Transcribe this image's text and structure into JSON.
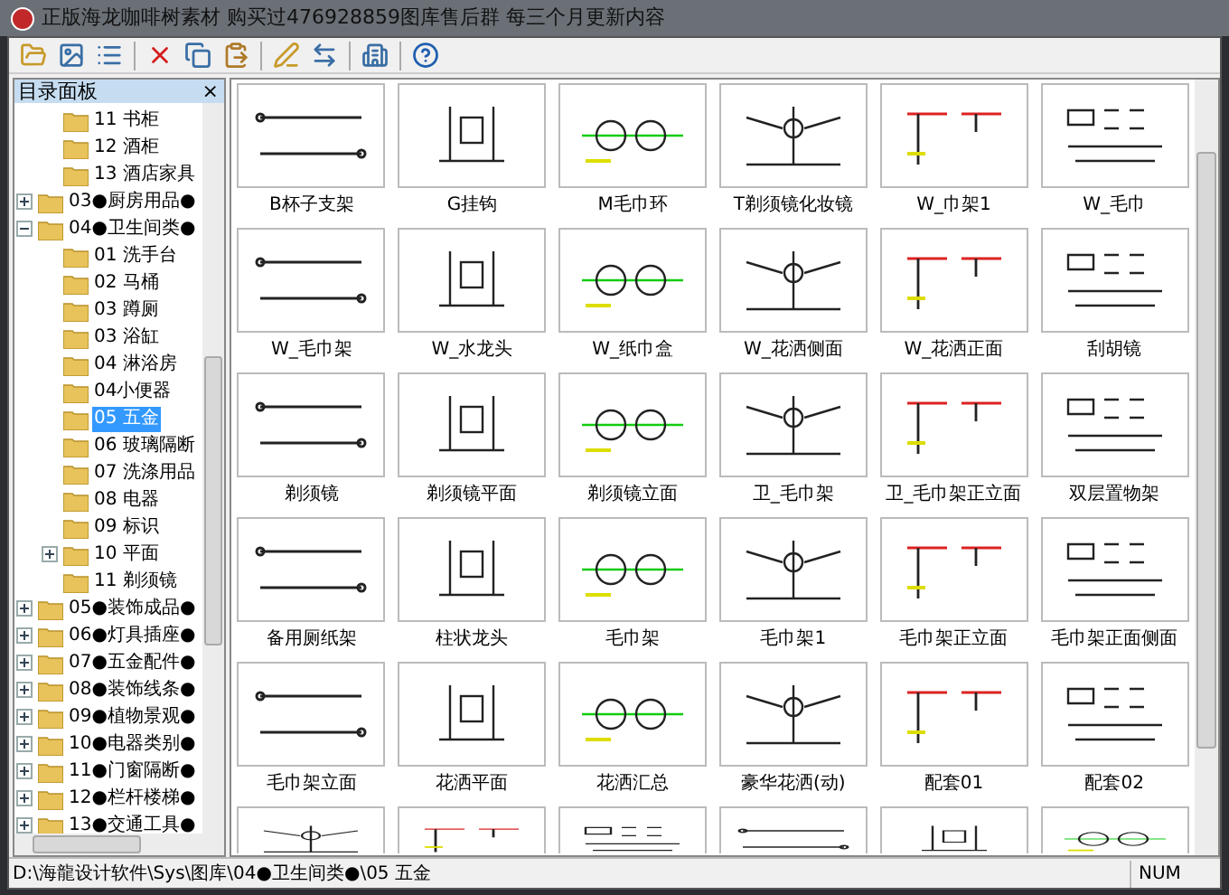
{
  "window": {
    "title": "正版海龙咖啡树素材 购买过476928859图库售后群 每三个月更新内容"
  },
  "catalog_panel": {
    "title": "目录面板",
    "close": "×",
    "continued_children": [
      {
        "label": "11 书柜",
        "selected": false
      },
      {
        "label": "12 酒柜",
        "selected": false
      },
      {
        "label": "13 酒店家具",
        "selected": false
      }
    ],
    "items": [
      {
        "label": "03●厨房用品●",
        "expanded": false,
        "selected": false
      },
      {
        "label": "04●卫生间类●",
        "expanded": true,
        "selected": false,
        "children": [
          {
            "label": "01 洗手台",
            "selected": false
          },
          {
            "label": "02 马桶",
            "selected": false
          },
          {
            "label": "03 蹲厕",
            "selected": false
          },
          {
            "label": "03 浴缸",
            "selected": false
          },
          {
            "label": "04 淋浴房",
            "selected": false
          },
          {
            "label": "04小便器",
            "selected": false
          },
          {
            "label": "05 五金",
            "selected": true
          },
          {
            "label": "06 玻璃隔断",
            "selected": false
          },
          {
            "label": "07 洗涤用品",
            "selected": false
          },
          {
            "label": "08 电器",
            "selected": false
          },
          {
            "label": "09 标识",
            "selected": false
          },
          {
            "label": "10 平面",
            "expanded": false,
            "selected": false
          },
          {
            "label": "11 剃须镜",
            "selected": false
          }
        ]
      },
      {
        "label": "05●装饰成品●",
        "expanded": false,
        "selected": false
      },
      {
        "label": "06●灯具插座●",
        "expanded": false,
        "selected": false
      },
      {
        "label": "07●五金配件●",
        "expanded": false,
        "selected": false
      },
      {
        "label": "08●装饰线条●",
        "expanded": false,
        "selected": false
      },
      {
        "label": "09●植物景观●",
        "expanded": false,
        "selected": false
      },
      {
        "label": "10●电器类别●",
        "expanded": false,
        "selected": false
      },
      {
        "label": "11●门窗隔断●",
        "expanded": false,
        "selected": false
      },
      {
        "label": "12●栏杆楼梯●",
        "expanded": false,
        "selected": false
      },
      {
        "label": "13●交通工具●",
        "expanded": false,
        "selected": false
      }
    ]
  },
  "gallery": {
    "items": [
      {
        "label": "B杯子支架"
      },
      {
        "label": "G挂钩"
      },
      {
        "label": "M毛巾环"
      },
      {
        "label": "T剃须镜化妆镜"
      },
      {
        "label": "W_巾架1"
      },
      {
        "label": "W_毛巾"
      },
      {
        "label": "W_毛巾架"
      },
      {
        "label": "W_水龙头"
      },
      {
        "label": "W_纸巾盒"
      },
      {
        "label": "W_花洒侧面"
      },
      {
        "label": "W_花洒正面"
      },
      {
        "label": "刮胡镜"
      },
      {
        "label": "剃须镜"
      },
      {
        "label": "剃须镜平面"
      },
      {
        "label": "剃须镜立面"
      },
      {
        "label": "卫_毛巾架"
      },
      {
        "label": "卫_毛巾架正立面"
      },
      {
        "label": "双层置物架"
      },
      {
        "label": "备用厕纸架"
      },
      {
        "label": "柱状龙头"
      },
      {
        "label": "毛巾架"
      },
      {
        "label": "毛巾架1"
      },
      {
        "label": "毛巾架正立面"
      },
      {
        "label": "毛巾架正面侧面"
      },
      {
        "label": "毛巾架立面"
      },
      {
        "label": "花洒平面"
      },
      {
        "label": "花洒汇总"
      },
      {
        "label": "豪华花洒(动)"
      },
      {
        "label": "配套01"
      },
      {
        "label": "配套02"
      }
    ]
  },
  "status_bar": {
    "path": "D:\\海龍设计软件\\Sys\\图库\\04●卫生间类●\\05 五金",
    "num": "NUM"
  }
}
